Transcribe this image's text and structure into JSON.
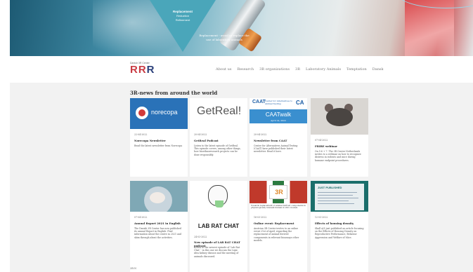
{
  "hero": {
    "triangle_lines": [
      "Replacement",
      "Reduction",
      "Refinement"
    ],
    "caption": "Replacement - avoid or replace the use of laboratory animals"
  },
  "logo": {
    "small": "Danish 3R Center",
    "big_a": "RR",
    "big_b": "R"
  },
  "nav": {
    "items": [
      "About us",
      "Research",
      "3R organizations",
      "3R",
      "Laboratory Animals",
      "Temptation",
      "Dansk"
    ]
  },
  "news": {
    "title": "3R-news from around the world",
    "cards": [
      {
        "date": "22-04-2022",
        "title": "Norecopa Newsletter",
        "desc": "Read the latest newsletter from Norecopa",
        "image": "norecopa-logo",
        "image_text": "norecopa"
      },
      {
        "date": "20-04-2022",
        "title": "GetReal Podcast",
        "desc": "Listen to the latest episode of GetReal. This episode covers, among other things, how bioethnoresearch projects can be done responsibly.",
        "image": "getreal-logo",
        "image_text": "GetReal!"
      },
      {
        "date": "20-04-2022",
        "title": "Newsletter from CAAT",
        "desc": "Center for Alternatives Animal Testing (CAAT) have published their latest newsletter. Read it here.",
        "image": "caat-banner",
        "image_text": "CAATwalk",
        "image_sub": "April 14, 2022",
        "image_org": "Center for Alternatives to Animal Testing",
        "image_logo_l": "CAAT",
        "image_logo_r": "CA"
      },
      {
        "date": "07-04-2022",
        "title": "FRIRE webinar",
        "desc": "On 5-6 + 7. The 3R Center Netherlands invites to a webinar on how to recognize distress in rodents and mice during humane endpoint procedures.",
        "image": "mouse-photo"
      },
      {
        "date": "07-04-2022",
        "title": "Annual Report 2021 in English",
        "desc": "The Danish 3R Center has now published its annual Report in English. Find information about the centre in 2021 and skim through about the activities.",
        "image": "rat-photo"
      },
      {
        "date": "24-03-2022",
        "title": "New episode of LAB RAT CHAT podcast",
        "desc": "Listen to the newest episode of 'Lab Rat Chat' - in this one we discuss the topic idea kidney disease and the meeting of animals discussed.",
        "image": "lab-rat-chat-logo",
        "image_text": "LAB RAT CHAT"
      },
      {
        "date": "16-03-2022",
        "title": "Online event: Replacement",
        "desc": "Austrian 3R Center invites to an online event 21st of April, regarding the replacement of animal-derived components in relevant bioassays other models.",
        "image": "austrian-3r-banner",
        "image_text": "3R",
        "image_sub": "Towards replacement of animal derived components in physiologically relevant human in vitro models"
      },
      {
        "date": "12-03-2022",
        "title": "Effects of housing density",
        "desc": "Skall A/S just published an article focusing on the Effects of Housing Density on Reproductive Performance, Behavior Aggression and Welfare of Mice.",
        "image": "paper-published",
        "image_text": "JUST PUBLISHED"
      }
    ]
  },
  "footer": {
    "text": "3R-N"
  }
}
